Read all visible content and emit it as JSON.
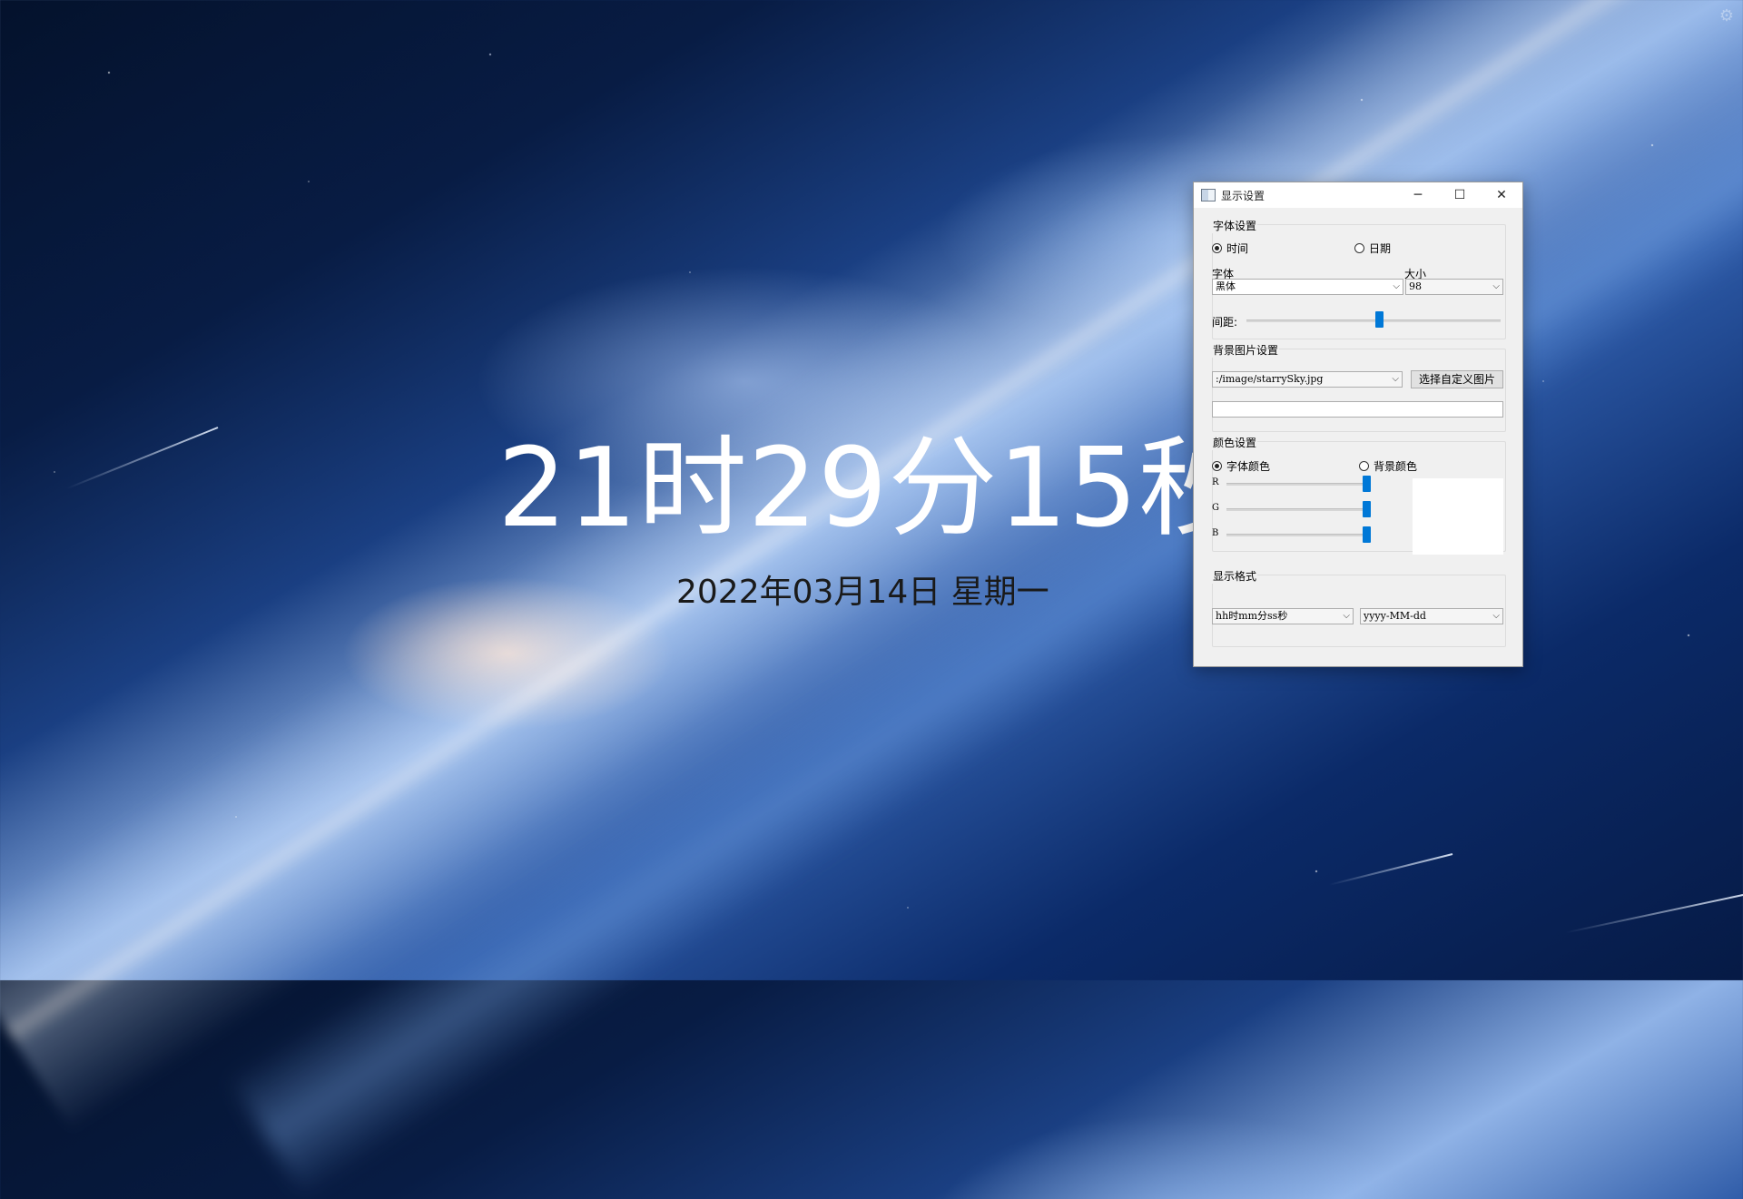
{
  "clock": {
    "time": "21时29分15秒",
    "date": "2022年03月14日  星期一"
  },
  "dialog": {
    "title": "显示设置",
    "window_buttons": {
      "minimize": "─",
      "maximize": "☐",
      "close": "✕"
    },
    "font_group": {
      "title": "字体设置",
      "radio_time": "时间",
      "radio_date": "日期",
      "selected": "时间",
      "font_label": "字体",
      "font_value": "黑体",
      "size_label": "大小",
      "size_value": "98",
      "spacing_label": "间距:",
      "spacing_level": 0.52
    },
    "bg_group": {
      "title": "背景图片设置",
      "path_value": ":/image/starrySky.jpg",
      "choose_button": "选择自定义图片",
      "custom_path_value": ""
    },
    "color_group": {
      "title": "颜色设置",
      "radio_font": "字体颜色",
      "radio_bg": "背景颜色",
      "selected": "字体颜色",
      "r_label": "R",
      "g_label": "G",
      "b_label": "B",
      "r_value": 255,
      "g_value": 255,
      "b_value": 255,
      "preview_color": "#ffffff"
    },
    "format_group": {
      "title": "显示格式",
      "time_format": "hh时mm分ss秒",
      "date_format": "yyyy-MM-dd"
    }
  },
  "colors": {
    "accent": "#0078d7",
    "clock_text": "#ffffff",
    "date_text": "#1a1a1a"
  }
}
